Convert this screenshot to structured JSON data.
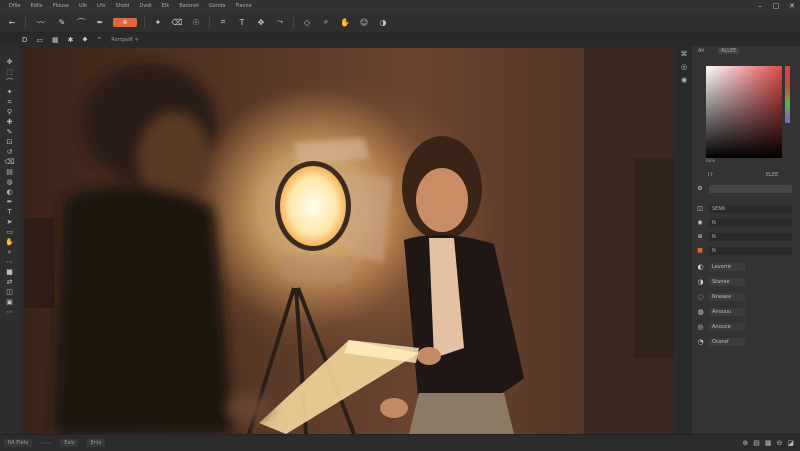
{
  "menu": {
    "items": [
      "Dfile",
      "Edlle",
      "Plouse",
      "Ulk",
      "Lfis",
      "Shold",
      "Dvsk",
      "Elk",
      "Baronet",
      "Gorida",
      "Fiavne"
    ]
  },
  "window_controls": {
    "minimize": "–",
    "maximize": "□",
    "close": "✕"
  },
  "toolbar": {
    "icons": [
      "back-arrow-icon",
      "wave-icon",
      "brush-icon",
      "lasso-icon",
      "pen-icon",
      "mode-pill",
      "wand-icon",
      "eraser-icon",
      "smudge-icon",
      "crop-icon",
      "text-icon",
      "move-icon",
      "path-icon",
      "shape-icon",
      "zoom-icon",
      "hand-icon",
      "heal-icon",
      "gradient-icon"
    ],
    "accent_pill_label": "≋"
  },
  "options_bar": {
    "label": "Rorrpadt ∓",
    "icons": [
      "D",
      "▭",
      "▦",
      "✱",
      "⬥",
      "⌃"
    ]
  },
  "right_panel": {
    "tab_label": "Ah",
    "tab_value": "ALLEE",
    "picker_caption": "Falie",
    "value_a": "I↑",
    "value_b": "ELEE",
    "prop_rows": [
      {
        "icon": "◫",
        "value": "SEN6"
      },
      {
        "icon": "◉",
        "value": "N"
      },
      {
        "icon": "⊕",
        "value": "N"
      },
      {
        "icon": "■",
        "value": "N"
      }
    ],
    "layers": [
      {
        "icon": "◐",
        "name": "Leverre"
      },
      {
        "icon": "◑",
        "name": "Stanee"
      },
      {
        "icon": "◌",
        "name": "Nneaee"
      },
      {
        "icon": "◍",
        "name": "Anouuu"
      },
      {
        "icon": "◎",
        "name": "Anouce"
      },
      {
        "icon": "◔",
        "name": "Ocaraf"
      }
    ]
  },
  "status_bar": {
    "items": [
      "RA Flets",
      "",
      "Ealz",
      "Ents"
    ],
    "right_icons": [
      "⊕",
      "▤",
      "▦",
      "⊖",
      "◪"
    ]
  },
  "colors": {
    "accent": "#e0643c",
    "panel_bg": "#333333",
    "app_bg": "#2b2b2b"
  }
}
